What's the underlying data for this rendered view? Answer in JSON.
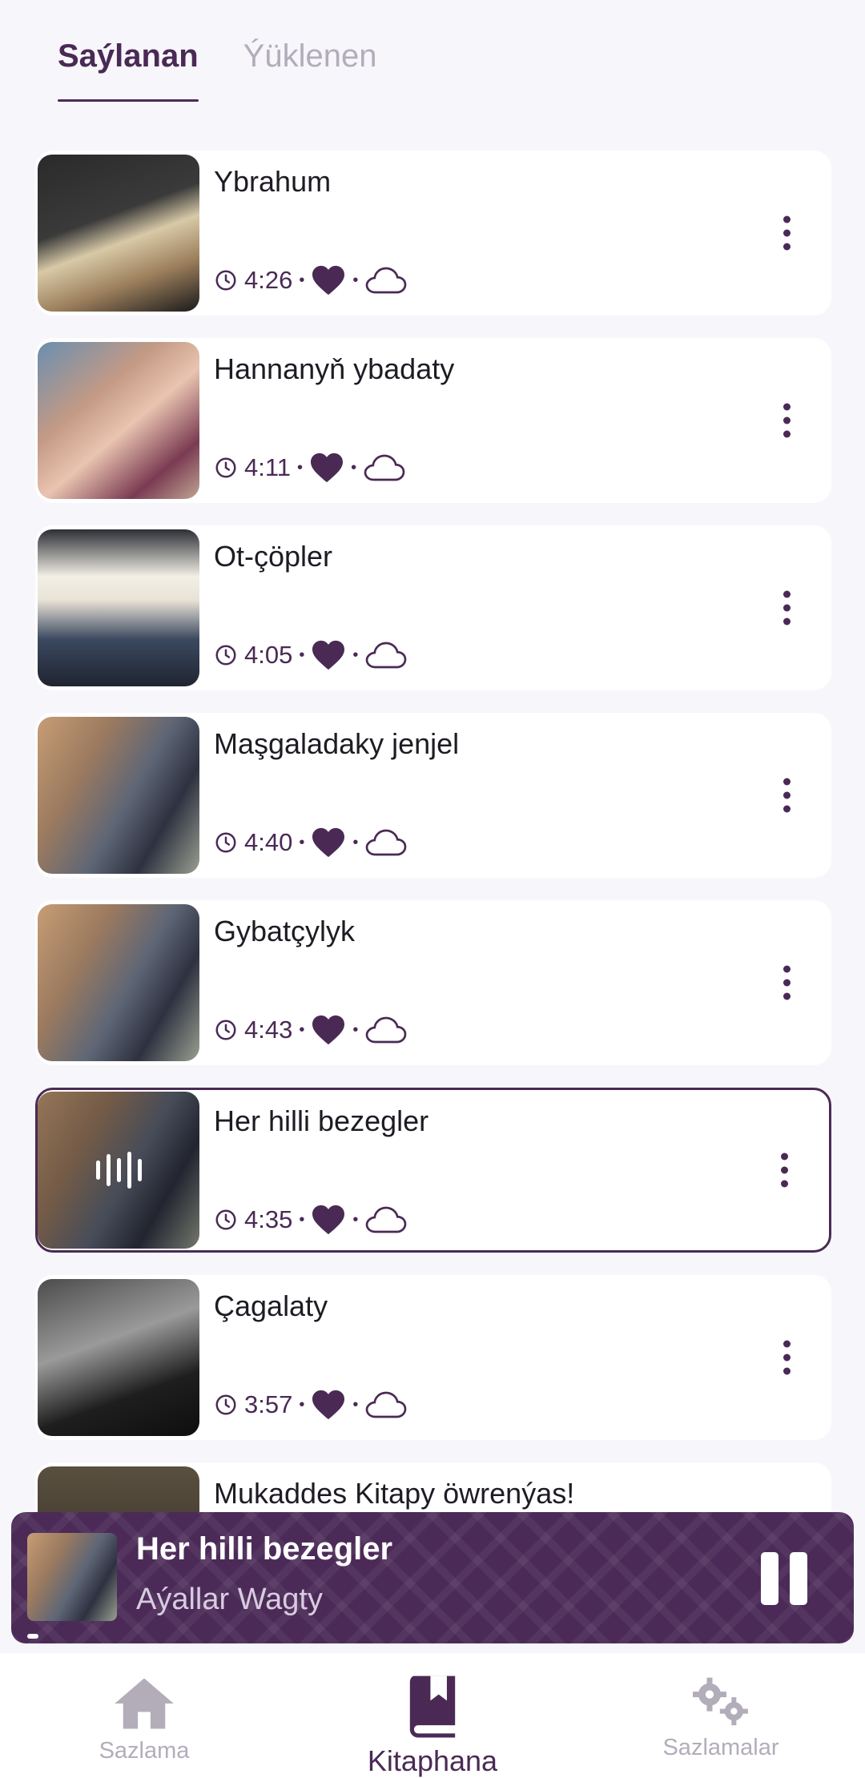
{
  "tabs": [
    {
      "label": "Saýlanan",
      "active": true
    },
    {
      "label": "Ýüklenen",
      "active": false
    }
  ],
  "tracks": [
    {
      "title": "Ybrahum",
      "duration": "4:26",
      "thumb": "open-book-photo"
    },
    {
      "title": "Hannanyň ybadaty",
      "duration": "4:11",
      "thumb": "boy-praying-photo"
    },
    {
      "title": "Ot-çöpler",
      "duration": "4:05",
      "thumb": "reading-bible-photo"
    },
    {
      "title": "Maşgaladaky jenjel",
      "duration": "4:40",
      "thumb": "woman-holding-bible-photo"
    },
    {
      "title": "Gybatçylyk",
      "duration": "4:43",
      "thumb": "woman-holding-bible-photo"
    },
    {
      "title": "Her hilli bezegler",
      "duration": "4:35",
      "thumb": "woman-holding-bible-photo",
      "playing": true
    },
    {
      "title": "Çagalaty",
      "duration": "3:57",
      "thumb": "bw-reading-photo"
    },
    {
      "title": "Mukaddes Kitapy öwrenýas!",
      "duration": "",
      "thumb": "dark-photo"
    }
  ],
  "meta_separator": "•",
  "player": {
    "title": "Her hilli bezegler",
    "subtitle": "Aýallar Wagty",
    "progress_fraction": 0.01
  },
  "nav": [
    {
      "label": "Sazlama",
      "icon": "home-icon",
      "active": false
    },
    {
      "label": "Kitaphana",
      "icon": "book-bookmark-icon",
      "active": true
    },
    {
      "label": "Sazlamalar",
      "icon": "gears-icon",
      "active": false
    }
  ],
  "colors": {
    "accent": "#4a2a55",
    "player_bg": "#4b2a58",
    "background": "#f7f6fb",
    "inactive": "#b3adba"
  }
}
